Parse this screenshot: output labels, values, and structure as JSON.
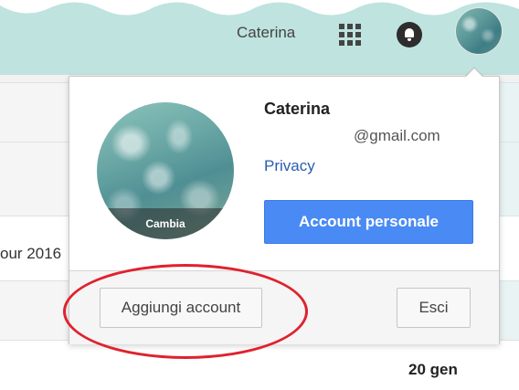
{
  "header": {
    "user_name": "Caterina",
    "apps_icon": "apps-grid-icon",
    "notifications_icon": "bell-icon",
    "avatar_icon": "avatar"
  },
  "background": {
    "partial_text": "our 2016",
    "date_text": "20 gen"
  },
  "account_popup": {
    "name": "Caterina",
    "email": "@gmail.com",
    "privacy_link": "Privacy",
    "account_button": "Account personale",
    "change_photo_label": "Cambia",
    "add_account_button": "Aggiungi account",
    "sign_out_button": "Esci"
  },
  "colors": {
    "header_wave": "#bfe3de",
    "primary_button": "#4a8af4",
    "link": "#2a5db0",
    "annotation": "#e0212e"
  }
}
